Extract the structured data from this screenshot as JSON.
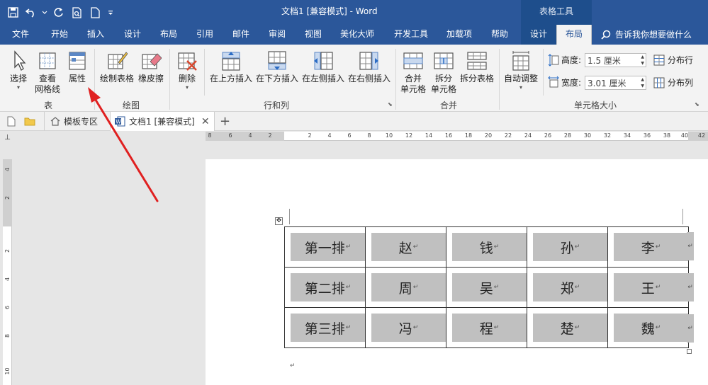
{
  "app": {
    "window_title": "文档1 [兼容模式] - Word",
    "context_header": "表格工具"
  },
  "menu": {
    "tabs": [
      {
        "label": "文件"
      },
      {
        "label": "开始"
      },
      {
        "label": "插入"
      },
      {
        "label": "设计"
      },
      {
        "label": "布局"
      },
      {
        "label": "引用"
      },
      {
        "label": "邮件"
      },
      {
        "label": "审阅"
      },
      {
        "label": "视图"
      },
      {
        "label": "美化大师"
      },
      {
        "label": "开发工具"
      },
      {
        "label": "加载项"
      },
      {
        "label": "帮助"
      },
      {
        "label": "设计"
      },
      {
        "label": "布局"
      }
    ],
    "tell_me": "告诉我你想要做什么"
  },
  "ribbon": {
    "select": "选择",
    "view_gridlines_1": "查看",
    "view_gridlines_2": "网格线",
    "properties": "属性",
    "draw_table": "绘制表格",
    "eraser": "橡皮擦",
    "delete": "删除",
    "insert_above": "在上方插入",
    "insert_below": "在下方插入",
    "insert_left": "在左侧插入",
    "insert_right": "在右侧插入",
    "merge_cells_1": "合并",
    "merge_cells_2": "单元格",
    "split_cells_1": "拆分",
    "split_cells_2": "单元格",
    "split_table": "拆分表格",
    "autofit": "自动调整",
    "height_label": "高度:",
    "height_value": "1.5 厘米",
    "width_label": "宽度:",
    "width_value": "3.01 厘米",
    "distribute_rows": "分布行",
    "distribute_cols": "分布列",
    "groups": {
      "table": "表",
      "draw": "绘图",
      "rows_cols": "行和列",
      "merge": "合并",
      "cell_size": "单元格大小"
    }
  },
  "doc_tabs": {
    "template_zone": "模板专区",
    "document": "文档1 [兼容模式]"
  },
  "ruler": {
    "h_labels": [
      "8",
      "6",
      "4",
      "2",
      "2",
      "4",
      "6",
      "8",
      "10",
      "12",
      "14",
      "16",
      "18",
      "20",
      "22",
      "24",
      "26",
      "28",
      "30",
      "32",
      "34",
      "36",
      "38",
      "40",
      "42"
    ],
    "v_labels": [
      "4",
      "2",
      "2",
      "4",
      "6",
      "8",
      "10"
    ]
  },
  "table": {
    "rows": [
      [
        "第一排",
        "赵",
        "钱",
        "孙",
        "李"
      ],
      [
        "第二排",
        "周",
        "吴",
        "郑",
        "王"
      ],
      [
        "第三排",
        "冯",
        "程",
        "楚",
        "魏"
      ]
    ]
  },
  "colors": {
    "accent": "#2b579a",
    "context_tab": "#1e4e8c",
    "cell_shading": "#c0c0c0",
    "arrow": "#e02020"
  }
}
